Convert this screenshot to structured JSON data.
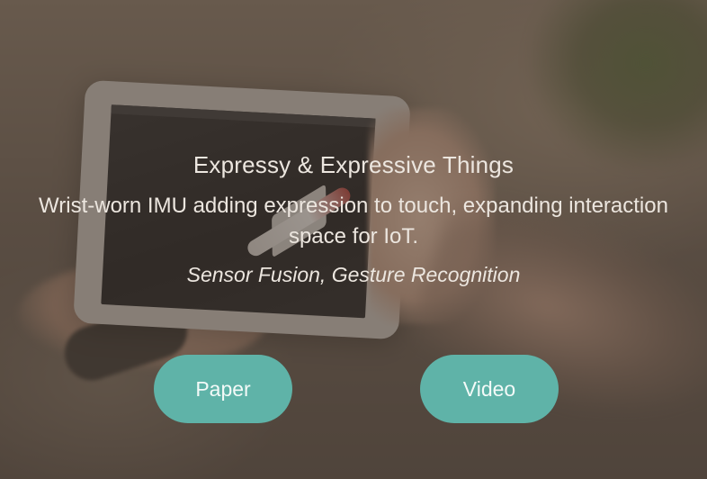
{
  "project": {
    "title": "Expressy & Expressive Things",
    "description": "Wrist-worn IMU adding expression to touch, expanding interaction space for IoT.",
    "tags": "Sensor Fusion, Gesture Recognition"
  },
  "actions": {
    "paper_label": "Paper",
    "video_label": "Video"
  },
  "colors": {
    "button": "#5fb3a8",
    "overlay": "#463a30",
    "text": "#ece6df"
  }
}
